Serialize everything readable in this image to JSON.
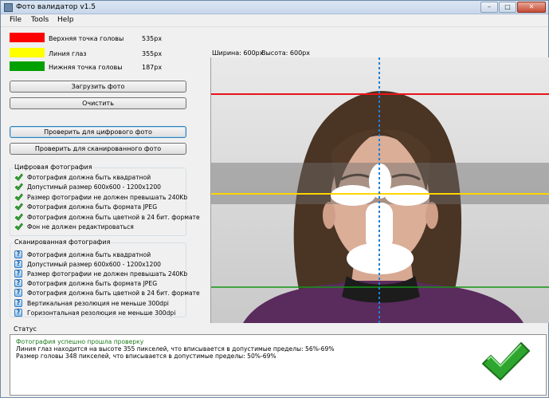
{
  "window": {
    "title": "Фото валидатор v1.5",
    "controls": {
      "minimize": "–",
      "maximize": "□",
      "close": "✕"
    }
  },
  "menu": [
    "File",
    "Tools",
    "Help"
  ],
  "legend": [
    {
      "label": "Верхняя точка головы",
      "value": "535px",
      "color": "#ff0000"
    },
    {
      "label": "Линия глаз",
      "value": "355px",
      "color": "#ffff00"
    },
    {
      "label": "Нижняя точка головы",
      "value": "187px",
      "color": "#00a000"
    }
  ],
  "buttons": {
    "load": "Загрузить фото",
    "clear": "Очистить",
    "check_digital": "Проверить для цифрового фото",
    "check_scanned": "Проверить для сканированного фото"
  },
  "digital": {
    "title": "Цифровая фотография",
    "items": [
      "Фотография должна быть квадратной",
      "Допустимый размер 600x600 - 1200x1200",
      "Размер фотографии не должен превышать 240Kb",
      "Фотография должна быть формата JPEG",
      "Фотография должна быть цветной в 24 бит. формате",
      "Фон не должен редактироваться"
    ]
  },
  "scanned": {
    "title": "Сканированная фотография",
    "items": [
      "Фотография должна быть квадратной",
      "Допустимый размер 600x600 - 1200x1200",
      "Размер фотографии не должен превышать 240Kb",
      "Фотография должна быть формата JPEG",
      "Фотография должна быть цветной в 24 бит. формате",
      "Вертикальная резолюция не меньше 300dpi",
      "Горизонтальная резолюция не меньше 300dpi"
    ]
  },
  "image_info": {
    "width": "Ширина: 600px",
    "height": "Высота: 600px"
  },
  "status": {
    "label": "Статус",
    "lines": [
      "Фотография успешно прошла проверку",
      "Линия глаз находится на высоте 355 пикселей, что вписывается в допустимые пределы: 56%-69%",
      "Размер головы 348 пикселей, что вписывается в допустимые пределы: 50%-69%"
    ],
    "success_color": "#1f7a1f"
  },
  "colors": {
    "check_green": "#2ea52e",
    "guide_blue": "#1e7fd8"
  }
}
